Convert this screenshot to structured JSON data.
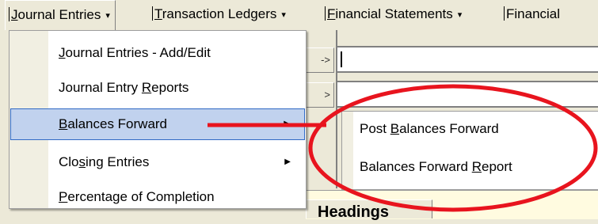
{
  "menubar": {
    "items": [
      {
        "pre": "",
        "key": "J",
        "post": "ournal Entries",
        "arrow": "▾"
      },
      {
        "pre": "",
        "key": "T",
        "post": "ransaction Ledgers",
        "arrow": "▾"
      },
      {
        "pre": "",
        "key": "F",
        "post": "inancial Statements",
        "arrow": "▾"
      },
      {
        "pre": "",
        "key": "",
        "post": "Financial",
        "arrow": ""
      }
    ]
  },
  "dropdown": {
    "items": [
      {
        "pre": "",
        "key": "J",
        "post": "ournal Entries - Add/Edit",
        "arrow": ""
      },
      {
        "pre": "Journal Entry ",
        "key": "R",
        "post": "eports",
        "arrow": ""
      },
      {
        "pre": "",
        "key": "B",
        "post": "alances Forward",
        "arrow": "▶"
      },
      {
        "pre": "Clo",
        "key": "s",
        "post": "ing Entries",
        "arrow": "▶"
      },
      {
        "pre": "",
        "key": "P",
        "post": "ercentage of Completion",
        "arrow": ""
      }
    ]
  },
  "submenu": {
    "items": [
      {
        "pre": "Post ",
        "key": "B",
        "post": "alances Forward"
      },
      {
        "pre": "Balances Forward ",
        "key": "R",
        "post": "eport"
      }
    ]
  },
  "background": {
    "button_glyph": "->",
    "heading": "Headings"
  },
  "colors": {
    "highlight": "#c1d2ee",
    "highlight_border": "#316ac5",
    "annotation": "#e8141e"
  }
}
